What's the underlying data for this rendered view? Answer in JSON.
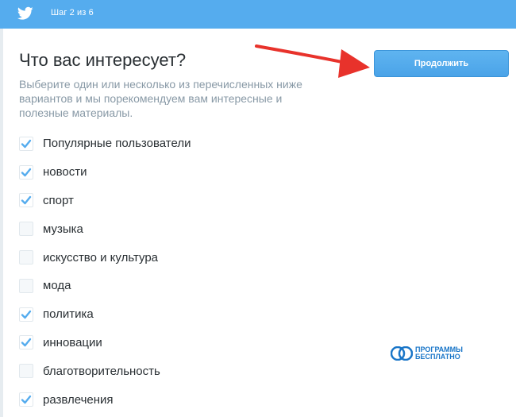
{
  "header": {
    "step_text": "Шаг 2 из 6",
    "bird_icon": "twitter-bird-icon",
    "bar_color": "#55acee"
  },
  "main": {
    "title": "Что вас интересует?",
    "subtitle": "Выберите один или несколько из перечисленных ниже вариантов и мы порекомендуем вам интересные и полезные материалы.",
    "continue_label": "Продолжить"
  },
  "options": [
    {
      "label": "Популярные пользователи",
      "checked": true
    },
    {
      "label": "новости",
      "checked": true
    },
    {
      "label": "спорт",
      "checked": true
    },
    {
      "label": "музыка",
      "checked": false
    },
    {
      "label": "искусство и культура",
      "checked": false
    },
    {
      "label": "мода",
      "checked": false
    },
    {
      "label": "политика",
      "checked": true
    },
    {
      "label": "инновации",
      "checked": true
    },
    {
      "label": "благотворительность",
      "checked": false
    },
    {
      "label": "развлечения",
      "checked": true
    }
  ],
  "watermark": {
    "line1": "ПРОГРАММЫ",
    "line2": "БЕСПЛАТНО"
  },
  "colors": {
    "accent": "#55acee",
    "check": "#55acee",
    "arrow": "#e8322b"
  }
}
